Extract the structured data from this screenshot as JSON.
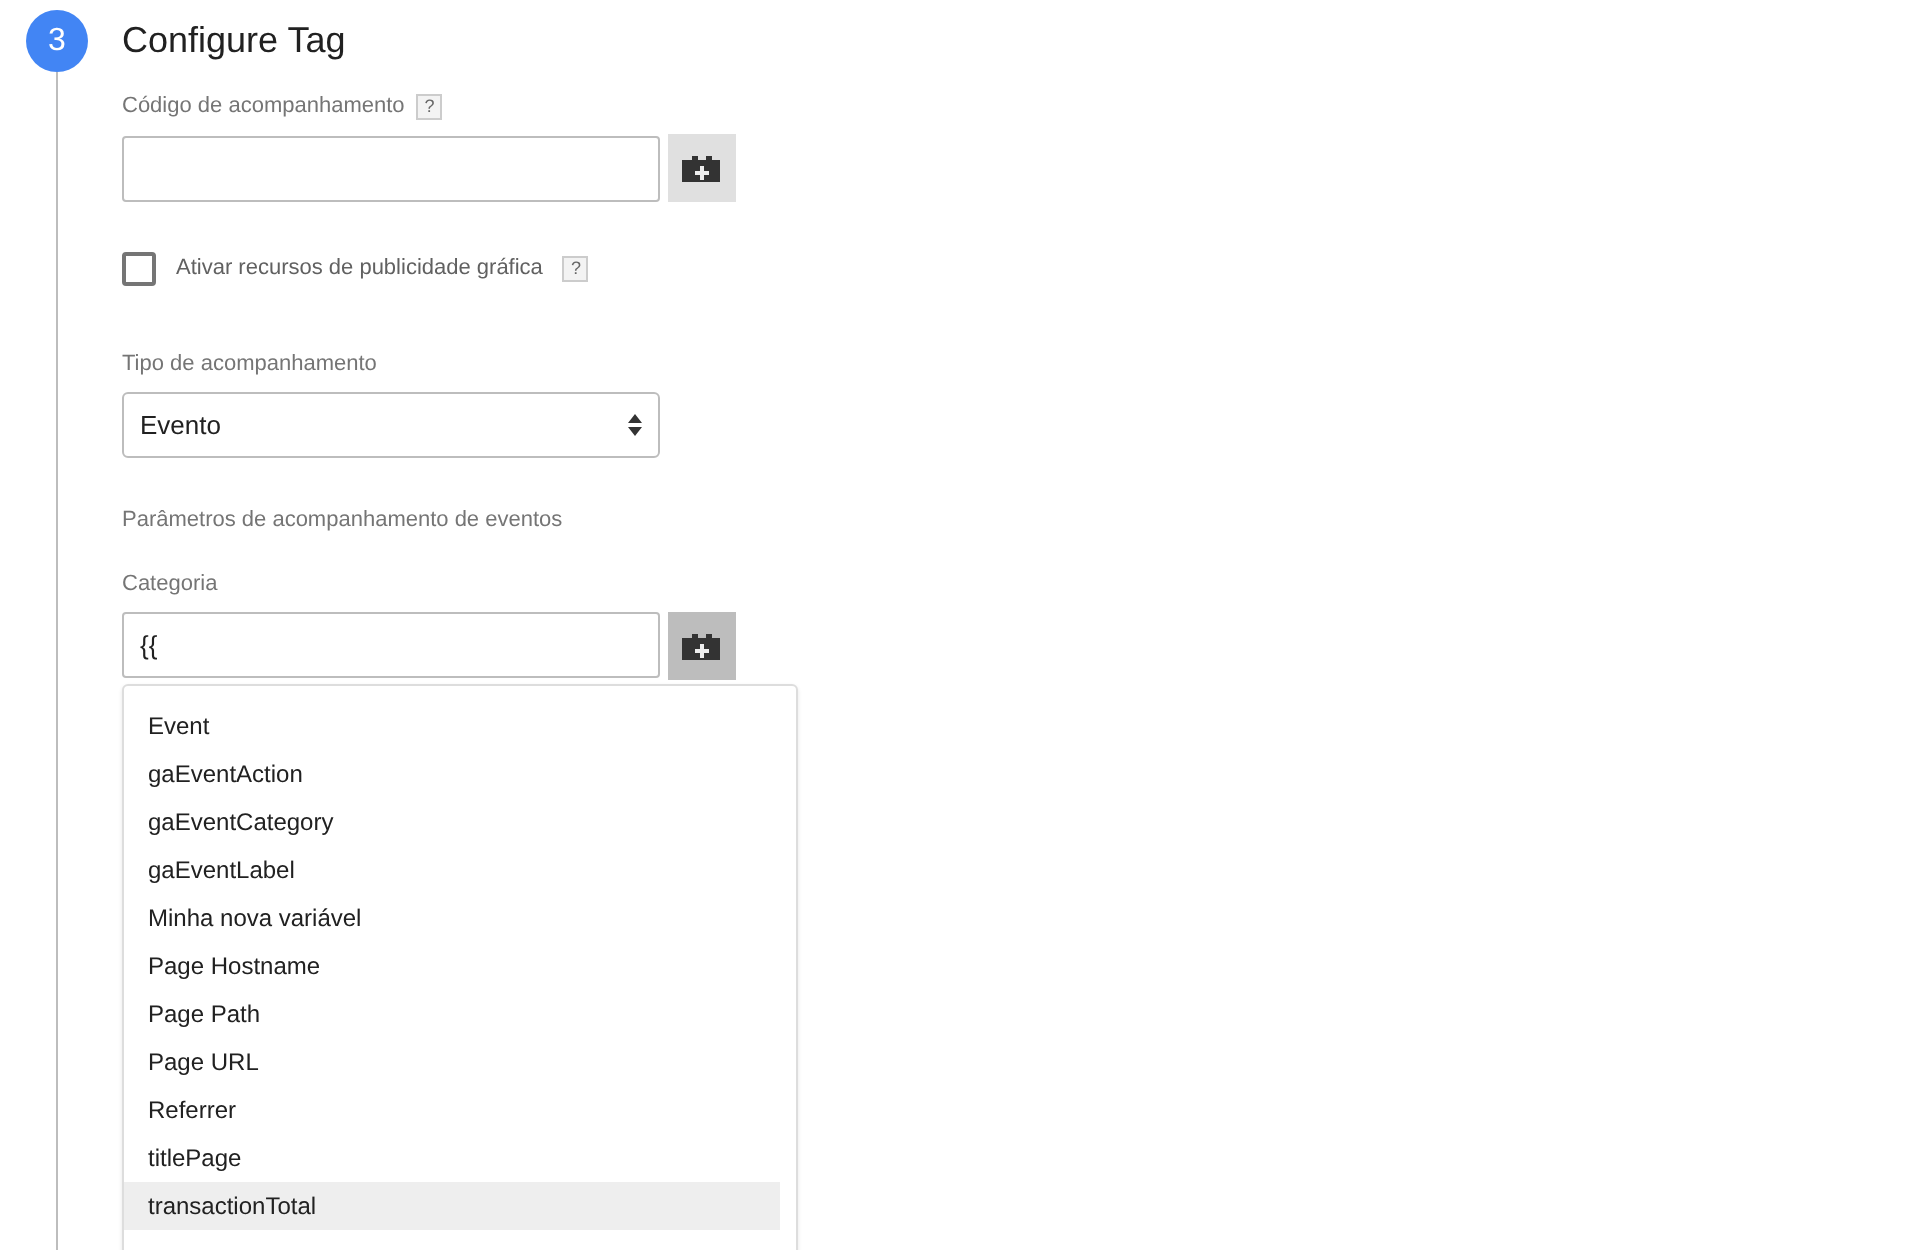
{
  "step": {
    "number": "3",
    "title": "Configure Tag"
  },
  "fields": [
    {
      "kind": "variable-input",
      "label": "Código de acompanhamento",
      "help": "?",
      "button_active": false
    },
    {
      "kind": "checkbox",
      "label": "Ativar recursos de publicidade gráfica",
      "help": "?",
      "checked": false
    },
    {
      "kind": "select",
      "label": "Tipo de acompanhamento",
      "value": "Evento"
    },
    {
      "kind": "section",
      "label": "Parâmetros de acompanhamento de eventos"
    },
    {
      "kind": "variable-input",
      "label": "Categoria",
      "value": "{{",
      "button_active": true,
      "suggestions": [
        {
          "label": "Event",
          "selected": false
        },
        {
          "label": "gaEventAction",
          "selected": false
        },
        {
          "label": "gaEventCategory",
          "selected": false
        },
        {
          "label": "gaEventLabel",
          "selected": false
        },
        {
          "label": "Minha nova variável",
          "selected": false
        },
        {
          "label": "Page Hostname",
          "selected": false
        },
        {
          "label": "Page Path",
          "selected": false
        },
        {
          "label": "Page URL",
          "selected": false
        },
        {
          "label": "Referrer",
          "selected": false
        },
        {
          "label": "titlePage",
          "selected": false
        },
        {
          "label": "transactionTotal",
          "selected": true
        }
      ]
    }
  ]
}
